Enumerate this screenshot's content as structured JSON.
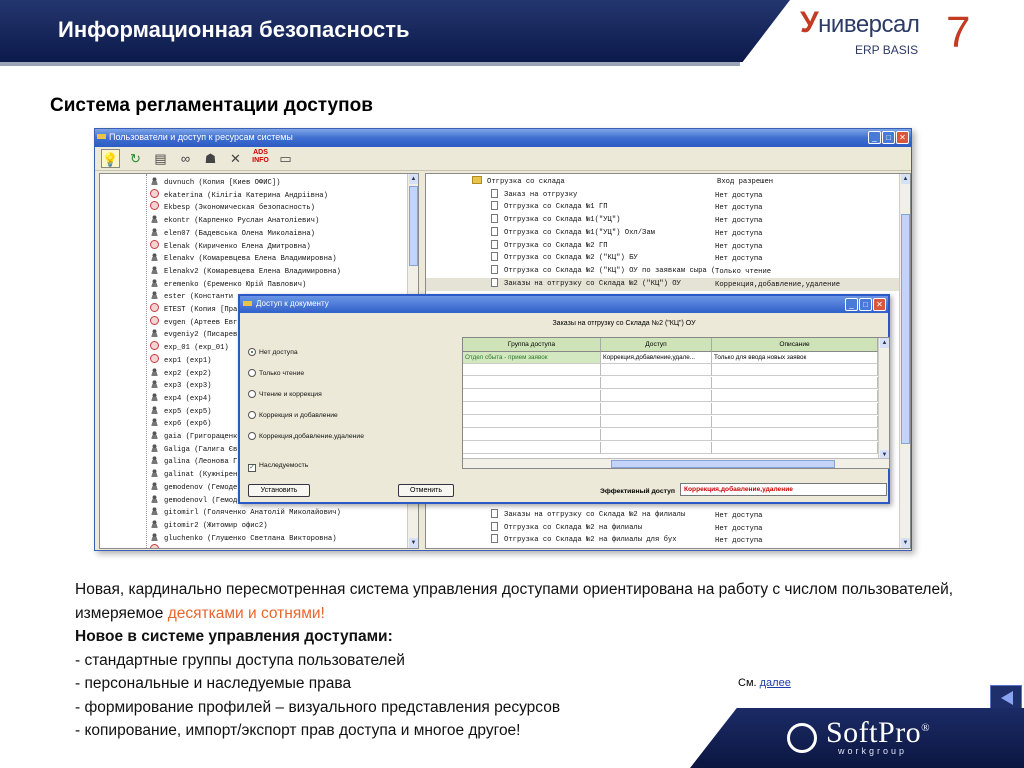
{
  "slide": {
    "title": "Информационная безопасность",
    "subtitle": "Система регламентации доступов",
    "logo_main_u": "У",
    "logo_main_rest": "ниверсал",
    "logo_seven": "7",
    "logo_sub": "ERP BASIS"
  },
  "window": {
    "title": "Пользователи и доступ к ресурсам системы",
    "toolbar_icons": [
      "bulb-icon",
      "refresh-icon",
      "user-new-icon",
      "binoculars-icon",
      "user-binoculars-icon",
      "tools-icon",
      "ads-info-icon",
      "window-icon"
    ]
  },
  "users": [
    {
      "text": "duvnuch (Копия [Киев ОФИС])",
      "icon": "plain"
    },
    {
      "text": "ekaterina (Кiлiгiа Катерина Андрiiвна)",
      "icon": "red"
    },
    {
      "text": "Ekbesp (Экономическая безопасность)",
      "icon": "red"
    },
    {
      "text": "ekontr (Карпенко Руслан Анатолiевич)",
      "icon": "plain"
    },
    {
      "text": "elen07 (Бадевська Олена Миколаiвна)",
      "icon": "plain"
    },
    {
      "text": "Elenak (Кириченко Елена Дмитровна)",
      "icon": "red"
    },
    {
      "text": "Elenakv (Комаревцева Елена Владимировна)",
      "icon": "plain"
    },
    {
      "text": "Elenakv2 (Комаревцева Елена Владимировна)",
      "icon": "plain"
    },
    {
      "text": "eremenko (Єременко Юрiй Павлович)",
      "icon": "plain"
    },
    {
      "text": "ester (Константи",
      "icon": "plain"
    },
    {
      "text": "ETEST (Копия [Пра",
      "icon": "red"
    },
    {
      "text": "evgen (Артеев Евг",
      "icon": "red"
    },
    {
      "text": "evgeniy2 (Писарев",
      "icon": "plain"
    },
    {
      "text": "exp_01 (exp_01)",
      "icon": "red"
    },
    {
      "text": "exp1 (exp1)",
      "icon": "red"
    },
    {
      "text": "exp2 (exp2)",
      "icon": "plain"
    },
    {
      "text": "exp3 (exp3)",
      "icon": "plain"
    },
    {
      "text": "exp4 (exp4)",
      "icon": "plain"
    },
    {
      "text": "exp5 (exp5)",
      "icon": "plain"
    },
    {
      "text": "exp6 (exp6)",
      "icon": "plain"
    },
    {
      "text": "gaia (Григоращенко Г",
      "icon": "plain"
    },
    {
      "text": "Galiga (Галига Єв",
      "icon": "plain"
    },
    {
      "text": "galina (Леонова Г",
      "icon": "plain"
    },
    {
      "text": "galinat (Кужнiрен",
      "icon": "plain"
    },
    {
      "text": "gemodenov (Гемоде",
      "icon": "plain"
    },
    {
      "text": "gemodenovl (Гемоде",
      "icon": "plain"
    },
    {
      "text": "gitomirl (Голяченко Анатолiй Миколайович)",
      "icon": "plain"
    },
    {
      "text": "gitomir2 (Житомир офис2)",
      "icon": "plain"
    },
    {
      "text": "gluchenko (Глушенко Светлана Викторовна)",
      "icon": "plain"
    },
    {
      "text": "",
      "icon": "red"
    }
  ],
  "resources": [
    {
      "name": "Отгрузка со склада",
      "access": "Вход разрешен",
      "folder": true
    },
    {
      "name": "Заказ на отгрузку",
      "access": "Нет доступа"
    },
    {
      "name": "Отгрузка со Склада №1 ГП",
      "access": "Нет доступа"
    },
    {
      "name": "Отгрузка со Склада №1(\"УЦ\")",
      "access": "Нет доступа"
    },
    {
      "name": "Отгрузка со Склада №1(\"УЦ\") Охл/Зам",
      "access": "Нет доступа"
    },
    {
      "name": "Отгрузка со Склада №2 ГП",
      "access": "Нет доступа"
    },
    {
      "name": "Отгрузка со Склада №2 (\"КЦ\") БУ",
      "access": "Нет доступа"
    },
    {
      "name": "Отгрузка со Склада №2 (\"КЦ\") ОУ по заявкам сыра (р",
      "access": "Только чтение"
    },
    {
      "name": "Заказы на отгрузку со Склада №2 (\"КЦ\") ОУ",
      "access": "Коррекция,добавление,удаление",
      "highlight": true
    }
  ],
  "resources_bottom": [
    {
      "name": "Заказы на отгрузку со Склада №2  на филиалы",
      "access": "Нет доступа"
    },
    {
      "name": "Отгрузка со Склада №2  на филиалы",
      "access": "Нет доступа"
    },
    {
      "name": "Отгрузка со Склада №2  на филиалы для бух",
      "access": "Нет доступа"
    }
  ],
  "dialog": {
    "title": "Доступ к документу",
    "heading": "Заказы на отгрузку со Склада №2 (\"КЦ\") ОУ",
    "options": [
      "Нет доступа",
      "Только чтение",
      "Чтение и коррекция",
      "Коррекция и добавление",
      "Коррекция,добавление,удаление"
    ],
    "selected_option": "Нет доступа",
    "inherit_label": "Наследуемость",
    "inherit_checked": true,
    "apply_label": "Установить",
    "cancel_label": "Отменить",
    "grid_headers": [
      "Группа доступа",
      "Доступ",
      "Описание"
    ],
    "grid_row": [
      "Отдел сбыта - прием заявок",
      "Коррекция,добавление,удале...",
      "Только для ввода новых заявок"
    ],
    "effective_label": "Эффективный доступ",
    "effective_value": "Коррекция,добавление,удаление"
  },
  "text": {
    "p1_a": "Новая, кардинально пересмотренная система управления доступами ориентирована на работу с числом пользователей, измеряемое ",
    "p1_highlight": "десятками и сотнями!",
    "p2": "Новое в системе управления доступами:",
    "bullets": [
      " - стандартные группы доступа пользователей",
      " - персональные и наследуемые права",
      " - формирование профилей – визуального представления ресурсов",
      " - копирование, импорт/экспорт прав доступа  и многое другое!"
    ],
    "see_prefix": "См. ",
    "see_link": "далее"
  },
  "footer": {
    "brand": "SoftPro",
    "reg": "®",
    "sub": "workgroup"
  },
  "colors": {
    "header_dark": "#0c1a4a",
    "accent_orange": "#e7662b",
    "brand_red": "#c23b22"
  }
}
